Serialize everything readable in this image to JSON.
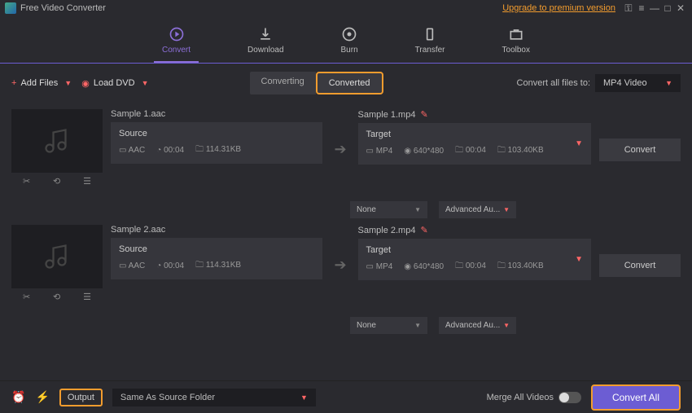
{
  "titlebar": {
    "title": "Free Video Converter",
    "premium": "Upgrade to premium version"
  },
  "nav": {
    "convert": "Convert",
    "download": "Download",
    "burn": "Burn",
    "transfer": "Transfer",
    "toolbox": "Toolbox"
  },
  "actions": {
    "addFiles": "Add Files",
    "loadDvd": "Load DVD"
  },
  "tabs": {
    "converting": "Converting",
    "converted": "Converted"
  },
  "convAll": {
    "label": "Convert all files to:",
    "value": "MP4 Video"
  },
  "files": [
    {
      "srcName": "Sample 1.aac",
      "srcLabel": "Source",
      "srcFormat": "AAC",
      "srcDur": "00:04",
      "srcSize": "114.31KB",
      "tgtName": "Sample 1.mp4",
      "tgtLabel": "Target",
      "tgtFormat": "MP4",
      "tgtRes": "640*480",
      "tgtDur": "00:04",
      "tgtSize": "103.40KB",
      "sub": "None",
      "audio": "Advanced Au...",
      "btn": "Convert"
    },
    {
      "srcName": "Sample 2.aac",
      "srcLabel": "Source",
      "srcFormat": "AAC",
      "srcDur": "00:04",
      "srcSize": "114.31KB",
      "tgtName": "Sample 2.mp4",
      "tgtLabel": "Target",
      "tgtFormat": "MP4",
      "tgtRes": "640*480",
      "tgtDur": "00:04",
      "tgtSize": "103.40KB",
      "sub": "None",
      "audio": "Advanced Au...",
      "btn": "Convert"
    }
  ],
  "bottom": {
    "output": "Output",
    "path": "Same As Source Folder",
    "merge": "Merge All Videos",
    "convertAll": "Convert All"
  }
}
